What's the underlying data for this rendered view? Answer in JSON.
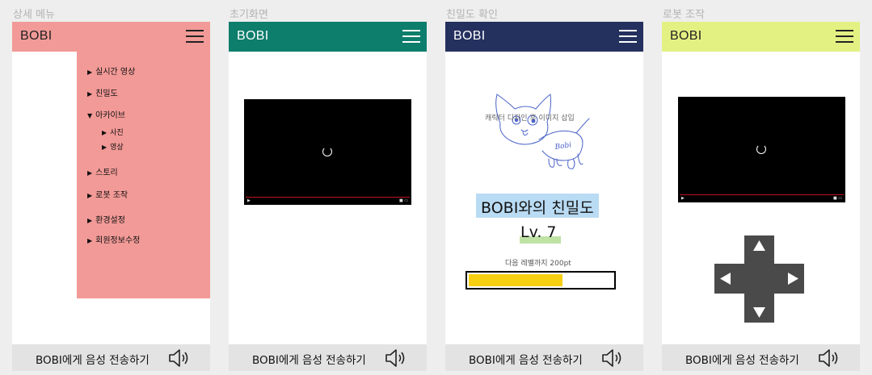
{
  "screens": [
    {
      "label": "상세 메뉴",
      "header_color": "#f29a97",
      "logo": "BOBI"
    },
    {
      "label": "초기화면",
      "header_color": "#0d7d6c",
      "logo": "BOBI"
    },
    {
      "label": "친밀도 확인",
      "header_color": "#24305e",
      "logo": "BOBI"
    },
    {
      "label": "로봇 조작",
      "header_color": "#e3f183",
      "logo": "BOBI"
    }
  ],
  "footer": {
    "label": "BOBI에게 음성 전송하기",
    "icon": "speaker-icon"
  },
  "menu": {
    "items": [
      {
        "label": "실시간 영상",
        "marker": "▶"
      },
      {
        "label": "친밀도",
        "marker": "▶"
      },
      {
        "label": "아카이브",
        "marker": "▼"
      },
      {
        "label": "사진",
        "marker": "▶"
      },
      {
        "label": "영상",
        "marker": "▶"
      },
      {
        "label": "스토리",
        "marker": "▶"
      },
      {
        "label": "로봇 조작",
        "marker": "▶"
      },
      {
        "label": "환경설정",
        "marker": "▶"
      },
      {
        "label": "회원정보수정",
        "marker": "▶"
      }
    ]
  },
  "affinity": {
    "caption": "캐릭터 디자인 후 이미지 삽입",
    "sketch_text": "Bobi",
    "title": "BOBI와의 친밀도",
    "level": "Lv. 7",
    "next_level": "다음 레벨까지 200pt",
    "progress": 0.65,
    "progress_color": "#f7cf11"
  },
  "dpad": {
    "up": "up-arrow-icon",
    "down": "down-arrow-icon",
    "left": "left-arrow-icon",
    "right": "right-arrow-icon"
  }
}
